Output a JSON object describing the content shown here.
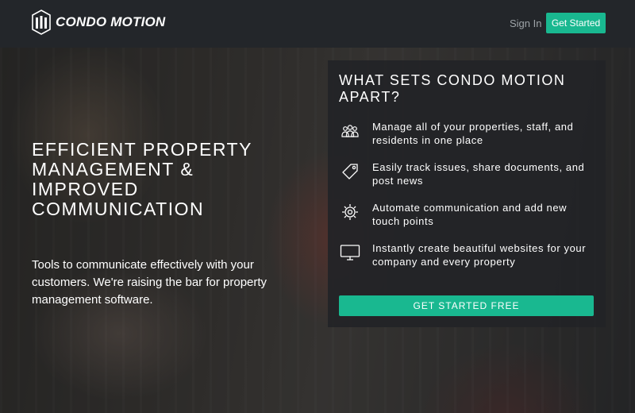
{
  "nav": {
    "brand": "CONDO MOTION",
    "sign_in": "Sign In",
    "get_started": "Get Started"
  },
  "hero": {
    "headline": "EFFICIENT PROPERTY MANAGEMENT & IMPROVED COMMUNICATION",
    "subtext": "Tools to communicate effectively with your customers. We're raising the bar for property management software."
  },
  "panel": {
    "title": "WHAT SETS CONDO MOTION APART?",
    "features": [
      {
        "icon": "people-group-icon",
        "text": "Manage all of your properties, staff, and residents in one place"
      },
      {
        "icon": "tag-icon",
        "text": "Easily track issues, share documents, and post news"
      },
      {
        "icon": "gear-icon",
        "text": "Automate communication and add new touch points"
      },
      {
        "icon": "monitor-icon",
        "text": "Instantly create beautiful websites for your company and every property"
      }
    ],
    "cta": "GET STARTED FREE"
  },
  "colors": {
    "accent": "#19b890",
    "nav_background": "#23262a",
    "panel_background": "#222427"
  }
}
